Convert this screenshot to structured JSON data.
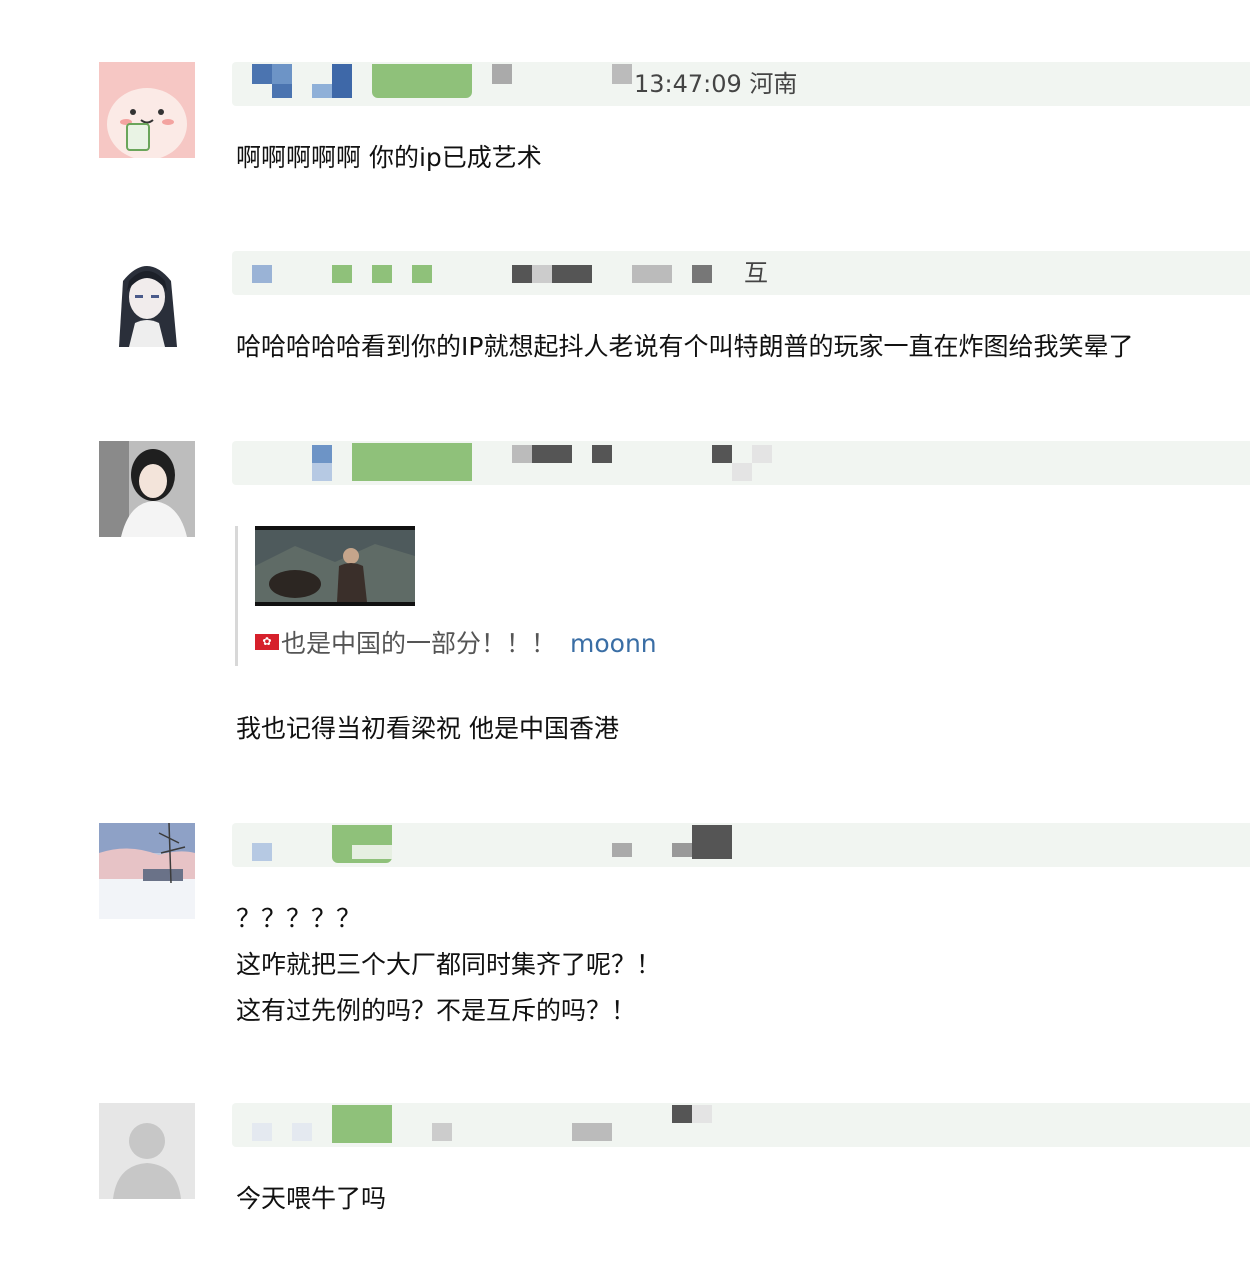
{
  "comments": [
    {
      "meta": "13:47:09 河南",
      "lines": [
        "啊啊啊啊啊 你的ip已成艺术"
      ]
    },
    {
      "meta": "互",
      "lines": [
        "哈哈哈哈哈看到你的IP就想起抖人老说有个叫特朗普的玩家一直在炸图给我笑晕了"
      ]
    },
    {
      "meta": "",
      "quote": {
        "flag": "✿",
        "text": "也是中国的一部分！！！",
        "user": "moonn"
      },
      "lines": [
        "我也记得当初看梁祝 他是中国香港"
      ]
    },
    {
      "meta": "",
      "lines": [
        "？？？？？",
        "这咋就把三个大厂都同时集齐了呢？！",
        "这有过先例的吗？不是互斥的吗？！"
      ]
    },
    {
      "meta": "",
      "lines": [
        "今天喂牛了吗"
      ]
    }
  ],
  "colors": {
    "meta_bar": "#f1f5f1",
    "link": "#3a6ea5",
    "pixel_green": "#8fc17a",
    "pixel_blue": "#5b87c0",
    "pixel_gray": "#555555"
  },
  "icons": [
    "avatar-pink-creature",
    "avatar-anime-girl",
    "avatar-woman-photo",
    "avatar-snow-landscape",
    "avatar-default-silhouette"
  ]
}
